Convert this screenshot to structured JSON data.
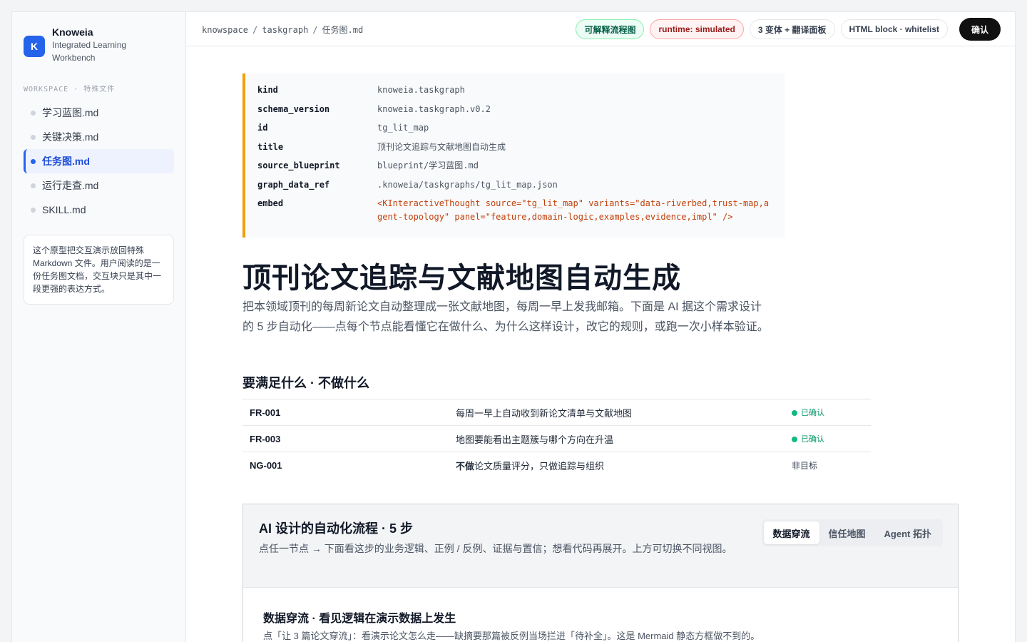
{
  "brand": {
    "logo": "K",
    "name": "Knoweia",
    "subtitle": "Integrated Learning Workbench"
  },
  "sidebar": {
    "section_label": "WORKSPACE · 特殊文件",
    "items": [
      {
        "label": "学习蓝图.md",
        "active": false
      },
      {
        "label": "关键决策.md",
        "active": false
      },
      {
        "label": "任务图.md",
        "active": true
      },
      {
        "label": "运行走查.md",
        "active": false
      },
      {
        "label": "SKILL.md",
        "active": false
      }
    ],
    "note": "这个原型把交互演示放回特殊 Markdown 文件。用户阅读的是一份任务图文档，交互块只是其中一段更强的表达方式。"
  },
  "topbar": {
    "breadcrumb": [
      "knowspace",
      "taskgraph",
      "任务图.md"
    ],
    "pills": [
      "可解释流程图",
      "runtime: simulated",
      "3 变体 + 翻译面板",
      "HTML block · whitelist"
    ],
    "confirm_label": "确认"
  },
  "meta": [
    {
      "key": "kind",
      "value": "knoweia.taskgraph"
    },
    {
      "key": "schema_version",
      "value": "knoweia.taskgraph.v0.2"
    },
    {
      "key": "id",
      "value": "tg_lit_map"
    },
    {
      "key": "title",
      "value": "顶刊论文追踪与文献地图自动生成"
    },
    {
      "key": "source_blueprint",
      "value": "blueprint/学习蓝图.md"
    },
    {
      "key": "graph_data_ref",
      "value": ".knoweia/taskgraphs/tg_lit_map.json"
    },
    {
      "key": "embed",
      "value": "<KInteractiveThought source=\"tg_lit_map\" variants=\"data-riverbed,trust-map,agent-topology\" panel=\"feature,domain-logic,examples,evidence,impl\" />"
    }
  ],
  "doc": {
    "title": "顶刊论文追踪与文献地图自动生成",
    "lede": "把本领域顶刊的每周新论文自动整理成一张文献地图，每周一早上发我邮箱。下面是 AI 据这个需求设计的 5 步自动化——点每个节点能看懂它在做什么、为什么这样设计，改它的规则，或跑一次小样本验证。",
    "requirements_heading": "要满足什么 · 不做什么",
    "requirements": [
      {
        "id": "FR-001",
        "prefix": "",
        "desc": "每周一早上自动收到新论文清单与文献地图",
        "status": "已确认",
        "confirmed": true
      },
      {
        "id": "FR-003",
        "prefix": "",
        "desc": "地图要能看出主题簇与哪个方向在升温",
        "status": "已确认",
        "confirmed": true
      },
      {
        "id": "NG-001",
        "prefix": "不做",
        "desc": "论文质量评分，只做追踪与组织",
        "status": "非目标",
        "confirmed": false
      }
    ]
  },
  "flow": {
    "title": "AI 设计的自动化流程 · 5 步",
    "desc": "点任一节点 → 下面看这步的业务逻辑、正例 / 反例、证据与置信；想看代码再展开。上方可切换不同视图。",
    "tabs": [
      "数据穿流",
      "信任地图",
      "Agent 拓扑"
    ],
    "active_tab": 0,
    "sub_title": "数据穿流 · 看见逻辑在演示数据上发生",
    "sub_desc": "点「让 3 篇论文穿流」：看演示论文怎么走——缺摘要那篇被反例当场拦进「待补全」。这是 Mermaid 静态方框做不到的。"
  }
}
